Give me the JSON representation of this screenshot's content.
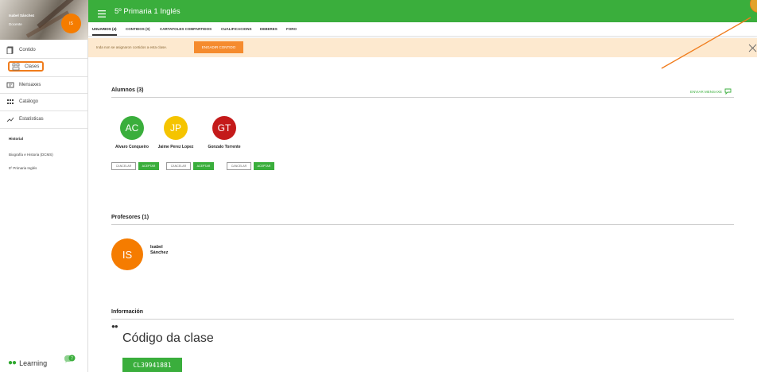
{
  "colors": {
    "brand_green": "#3aae3c",
    "accent_orange": "#f58b2e",
    "avatar_orange": "#f57c00",
    "student_ac": "#3aae3c",
    "student_jp": "#f5c400",
    "student_gt": "#c41a1a"
  },
  "sidebar": {
    "profile": {
      "name": "Isabel Sánchez",
      "role": "Docente",
      "avatar": "IS"
    },
    "items": [
      {
        "label": "Contido",
        "icon": "content-icon"
      },
      {
        "label": "Clases",
        "icon": "classes-icon"
      },
      {
        "label": "Mensaxes",
        "icon": "messages-icon"
      },
      {
        "label": "Catálogo",
        "icon": "catalog-icon"
      },
      {
        "label": "Estatísticas",
        "icon": "statistics-icon"
      }
    ],
    "history_title": "Historial",
    "history": [
      "Biografía e Historia (DCMS)",
      "5º Primaria Inglés"
    ],
    "brand": "Learning",
    "brand_badge": "7"
  },
  "topbar": {
    "title": "5º Primaria 1 Inglés"
  },
  "tabs": [
    "USUARIOS (4)",
    "CONTIDOS (0)",
    "CARTAFOLES COMPARTIDOS",
    "CUALIFICACIONS",
    "DEBERES",
    "FORO"
  ],
  "notice": {
    "text": "Inda non se asignaron contidos a esta clase.",
    "button": "ENGADIR CONTIDO"
  },
  "students_section": {
    "title": "Alumnos (3)",
    "send_message": "ENVIAR MENSAXE",
    "students": [
      {
        "initials": "AC",
        "name": "Alvaro Conqueiro"
      },
      {
        "initials": "JP",
        "name": "Jaime Perez Lopez"
      },
      {
        "initials": "GT",
        "name": "Gonzalo Torrente"
      }
    ],
    "cancel_label": "CANCELAR",
    "accept_label": "ACEPTAR"
  },
  "teachers_section": {
    "title": "Profesores (1)",
    "teacher": {
      "initials": "IS",
      "first": "Isabel",
      "last": "Sánchez"
    }
  },
  "info_section": {
    "title": "Información",
    "code_title": "Código da clase",
    "code": "CL39941881"
  }
}
